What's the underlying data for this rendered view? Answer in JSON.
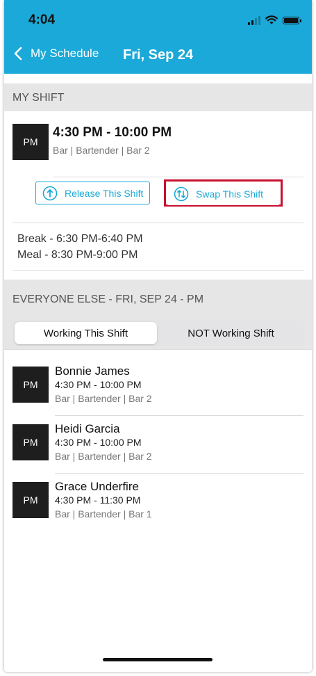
{
  "status": {
    "time": "4:04"
  },
  "header": {
    "back_label": "My Schedule",
    "title": "Fri, Sep 24"
  },
  "my_shift": {
    "section_title": "MY SHIFT",
    "badge": "PM",
    "time": "4:30 PM - 10:00 PM",
    "role": "Bar | Bartender | Bar 2",
    "release_label": "Release This Shift",
    "swap_label": "Swap This Shift",
    "breaks": [
      "Break - 6:30 PM-6:40 PM",
      "Meal - 8:30 PM-9:00 PM"
    ]
  },
  "everyone": {
    "section_title": "EVERYONE ELSE - FRI, SEP 24 - PM",
    "tabs": [
      "Working This Shift",
      "NOT Working Shift"
    ],
    "active_tab": "Working This Shift",
    "people": [
      {
        "badge": "PM",
        "name": "Bonnie James",
        "time": "4:30 PM - 10:00 PM",
        "role": "Bar | Bartender | Bar 2"
      },
      {
        "badge": "PM",
        "name": "Heidi Garcia",
        "time": "4:30 PM - 10:00 PM",
        "role": "Bar | Bartender | Bar 2"
      },
      {
        "badge": "PM",
        "name": "Grace Underfire",
        "time": "4:30 PM - 11:30 PM",
        "role": "Bar | Bartender | Bar 1"
      }
    ]
  },
  "colors": {
    "brand": "#1aa9d8",
    "highlight": "#c8102e",
    "badge_bg": "#1e1e1e"
  }
}
